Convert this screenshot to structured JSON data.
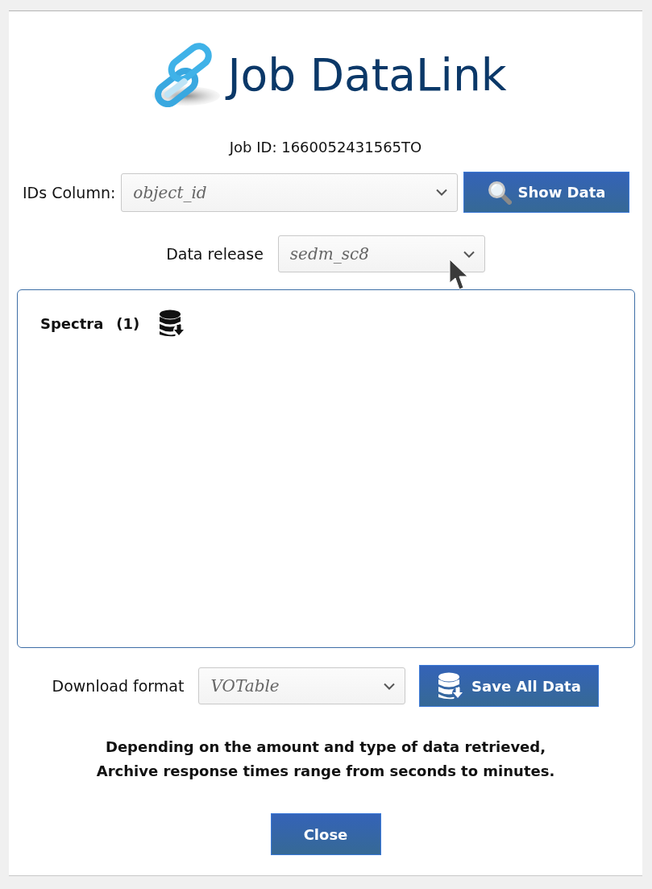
{
  "title": "Job DataLink",
  "job_id": "Job ID: 1660052431565TO",
  "ids_column": {
    "label": "IDs Column:",
    "value": "object_id"
  },
  "show_data_button": "Show Data",
  "data_release": {
    "label": "Data release",
    "value": "sedm_sc8"
  },
  "results": [
    {
      "name": "Spectra",
      "count": "(1)"
    }
  ],
  "download": {
    "label": "Download format",
    "value": "VOTable"
  },
  "save_button": "Save All Data",
  "notice": "Depending on the amount and type of data retrieved,\nArchive response times range from seconds to minutes.",
  "close_button": "Close"
}
